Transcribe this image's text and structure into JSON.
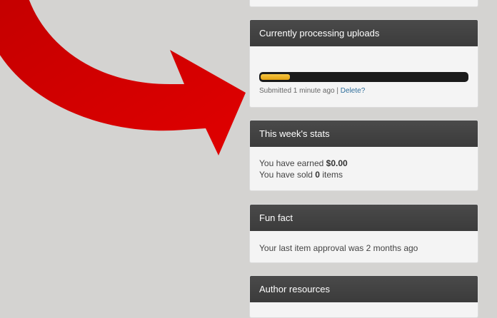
{
  "arrow": {
    "color": "#d10000"
  },
  "top_panel": {},
  "processing": {
    "title": "Currently processing uploads",
    "progress": 0.14,
    "progress_color": "#f0b428",
    "submitted": "Submitted 1 minute ago",
    "separator": "|",
    "delete_label": "Delete?"
  },
  "stats": {
    "title": "This week's stats",
    "earned_prefix": "You have earned",
    "earned_value": "$0.00",
    "sold_prefix": "You have sold",
    "sold_value": "0",
    "sold_suffix": "items"
  },
  "fun_fact": {
    "title": "Fun fact",
    "text": "Your last item approval was 2 months ago"
  },
  "resources": {
    "title": "Author resources"
  }
}
